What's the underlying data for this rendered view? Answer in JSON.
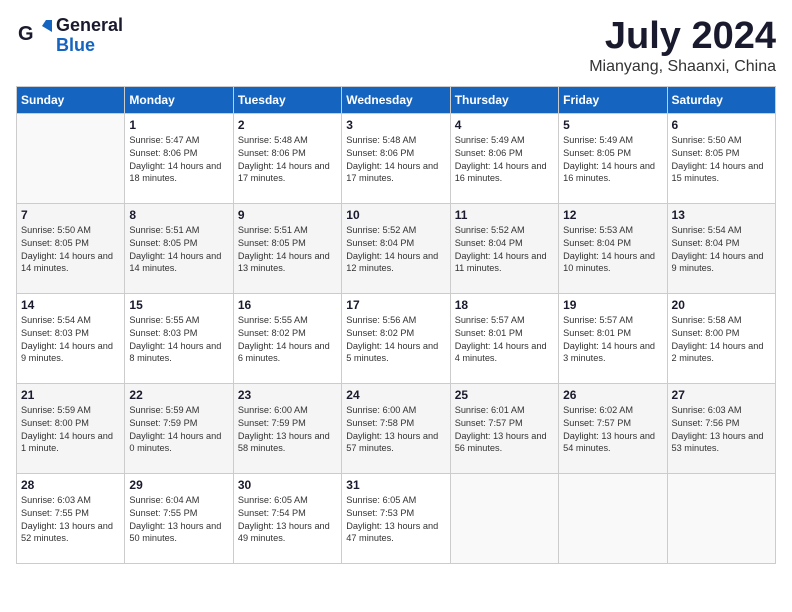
{
  "logo": {
    "line1": "General",
    "line2": "Blue"
  },
  "title": "July 2024",
  "location": "Mianyang, Shaanxi, China",
  "weekdays": [
    "Sunday",
    "Monday",
    "Tuesday",
    "Wednesday",
    "Thursday",
    "Friday",
    "Saturday"
  ],
  "weeks": [
    [
      {
        "day": "",
        "info": ""
      },
      {
        "day": "1",
        "info": "Sunrise: 5:47 AM\nSunset: 8:06 PM\nDaylight: 14 hours\nand 18 minutes."
      },
      {
        "day": "2",
        "info": "Sunrise: 5:48 AM\nSunset: 8:06 PM\nDaylight: 14 hours\nand 17 minutes."
      },
      {
        "day": "3",
        "info": "Sunrise: 5:48 AM\nSunset: 8:06 PM\nDaylight: 14 hours\nand 17 minutes."
      },
      {
        "day": "4",
        "info": "Sunrise: 5:49 AM\nSunset: 8:06 PM\nDaylight: 14 hours\nand 16 minutes."
      },
      {
        "day": "5",
        "info": "Sunrise: 5:49 AM\nSunset: 8:05 PM\nDaylight: 14 hours\nand 16 minutes."
      },
      {
        "day": "6",
        "info": "Sunrise: 5:50 AM\nSunset: 8:05 PM\nDaylight: 14 hours\nand 15 minutes."
      }
    ],
    [
      {
        "day": "7",
        "info": "Sunrise: 5:50 AM\nSunset: 8:05 PM\nDaylight: 14 hours\nand 14 minutes."
      },
      {
        "day": "8",
        "info": "Sunrise: 5:51 AM\nSunset: 8:05 PM\nDaylight: 14 hours\nand 14 minutes."
      },
      {
        "day": "9",
        "info": "Sunrise: 5:51 AM\nSunset: 8:05 PM\nDaylight: 14 hours\nand 13 minutes."
      },
      {
        "day": "10",
        "info": "Sunrise: 5:52 AM\nSunset: 8:04 PM\nDaylight: 14 hours\nand 12 minutes."
      },
      {
        "day": "11",
        "info": "Sunrise: 5:52 AM\nSunset: 8:04 PM\nDaylight: 14 hours\nand 11 minutes."
      },
      {
        "day": "12",
        "info": "Sunrise: 5:53 AM\nSunset: 8:04 PM\nDaylight: 14 hours\nand 10 minutes."
      },
      {
        "day": "13",
        "info": "Sunrise: 5:54 AM\nSunset: 8:04 PM\nDaylight: 14 hours\nand 9 minutes."
      }
    ],
    [
      {
        "day": "14",
        "info": "Sunrise: 5:54 AM\nSunset: 8:03 PM\nDaylight: 14 hours\nand 9 minutes."
      },
      {
        "day": "15",
        "info": "Sunrise: 5:55 AM\nSunset: 8:03 PM\nDaylight: 14 hours\nand 8 minutes."
      },
      {
        "day": "16",
        "info": "Sunrise: 5:55 AM\nSunset: 8:02 PM\nDaylight: 14 hours\nand 6 minutes."
      },
      {
        "day": "17",
        "info": "Sunrise: 5:56 AM\nSunset: 8:02 PM\nDaylight: 14 hours\nand 5 minutes."
      },
      {
        "day": "18",
        "info": "Sunrise: 5:57 AM\nSunset: 8:01 PM\nDaylight: 14 hours\nand 4 minutes."
      },
      {
        "day": "19",
        "info": "Sunrise: 5:57 AM\nSunset: 8:01 PM\nDaylight: 14 hours\nand 3 minutes."
      },
      {
        "day": "20",
        "info": "Sunrise: 5:58 AM\nSunset: 8:00 PM\nDaylight: 14 hours\nand 2 minutes."
      }
    ],
    [
      {
        "day": "21",
        "info": "Sunrise: 5:59 AM\nSunset: 8:00 PM\nDaylight: 14 hours\nand 1 minute."
      },
      {
        "day": "22",
        "info": "Sunrise: 5:59 AM\nSunset: 7:59 PM\nDaylight: 14 hours\nand 0 minutes."
      },
      {
        "day": "23",
        "info": "Sunrise: 6:00 AM\nSunset: 7:59 PM\nDaylight: 13 hours\nand 58 minutes."
      },
      {
        "day": "24",
        "info": "Sunrise: 6:00 AM\nSunset: 7:58 PM\nDaylight: 13 hours\nand 57 minutes."
      },
      {
        "day": "25",
        "info": "Sunrise: 6:01 AM\nSunset: 7:57 PM\nDaylight: 13 hours\nand 56 minutes."
      },
      {
        "day": "26",
        "info": "Sunrise: 6:02 AM\nSunset: 7:57 PM\nDaylight: 13 hours\nand 54 minutes."
      },
      {
        "day": "27",
        "info": "Sunrise: 6:03 AM\nSunset: 7:56 PM\nDaylight: 13 hours\nand 53 minutes."
      }
    ],
    [
      {
        "day": "28",
        "info": "Sunrise: 6:03 AM\nSunset: 7:55 PM\nDaylight: 13 hours\nand 52 minutes."
      },
      {
        "day": "29",
        "info": "Sunrise: 6:04 AM\nSunset: 7:55 PM\nDaylight: 13 hours\nand 50 minutes."
      },
      {
        "day": "30",
        "info": "Sunrise: 6:05 AM\nSunset: 7:54 PM\nDaylight: 13 hours\nand 49 minutes."
      },
      {
        "day": "31",
        "info": "Sunrise: 6:05 AM\nSunset: 7:53 PM\nDaylight: 13 hours\nand 47 minutes."
      },
      {
        "day": "",
        "info": ""
      },
      {
        "day": "",
        "info": ""
      },
      {
        "day": "",
        "info": ""
      }
    ]
  ]
}
